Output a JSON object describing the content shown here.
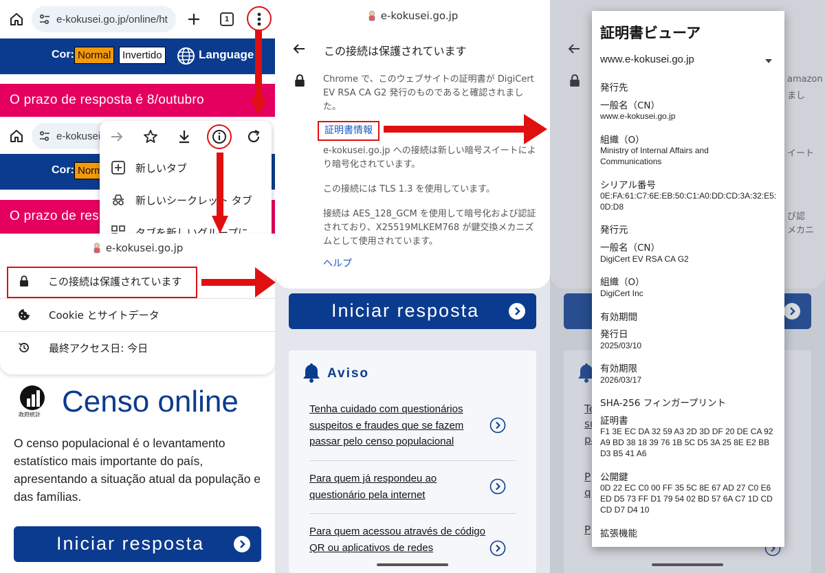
{
  "browser": {
    "url_full": "e-kokusei.go.jp/online/ht",
    "url_short": "e-kokusei",
    "tab_count": "1"
  },
  "site_header": {
    "cor_label": "Cor:",
    "normal_label": "Normal",
    "normal_short": "Norm",
    "invertido_label": "Invertido",
    "language_label": "Language"
  },
  "banner": {
    "deadline": "O prazo de resposta é 8/outubro",
    "deadline_partial": "O prazo de res"
  },
  "overflow_menu": {
    "new_tab": "新しいタブ",
    "incognito_tab": "新しいシークレット タブ",
    "group_tab": "タブを新しいグループに"
  },
  "site_info": {
    "host": "e-kokusei.go.jp",
    "connection_secure": "この接続は保護されています",
    "cookie_label": "Cookie とサイトデータ",
    "last_access": "最終アクセス日: 今日"
  },
  "page": {
    "logo_caption": "政府統計",
    "title": "Censo online",
    "description": "O censo populacional é o levantamento estatístico mais importante do país, apresentando a situação atual da população e das famílias.",
    "start_button": "Iniciar resposta"
  },
  "connection_detail": {
    "host": "e-kokusei.go.jp",
    "heading": "この接続は保護されています",
    "verified_text": "Chrome で、このウェブサイトの証明書が DigiCert EV RSA CA G2 発行のものであると確認されました。",
    "cert_info_link": "証明書情報",
    "cipher_suite_text": "e-kokusei.go.jp への接続は新しい暗号スイートにより暗号化されています。",
    "tls_text": "この接続には TLS 1.3 を使用しています。",
    "aes_text": "接続は AES_128_GCM を使用して暗号化および認証されており、X25519MLKEM768 が鍵交換メカニズムとして使用されています。",
    "help_link": "ヘルプ",
    "behind_fragment_1": "amazon",
    "behind_fragment_2": "まし",
    "behind_fragment_3": "イート",
    "behind_fragment_4": "び認",
    "behind_fragment_5": "メカニ"
  },
  "aviso": {
    "title": "Aviso",
    "links": [
      "Tenha cuidado com questionários suspeitos e fraudes que se fazem passar pelo censo populacional",
      "Para quem já respondeu ao questionário pela internet",
      "Para quem acessou através de código QR ou aplicativos de redes"
    ],
    "partial_letters": [
      "Te",
      "su",
      "pa",
      "P",
      "q",
      "P"
    ]
  },
  "certificate_viewer": {
    "title": "証明書ビューア",
    "selected": "www.e-kokusei.go.jp",
    "issued_to_heading": "発行先",
    "cn_label": "一般名（CN）",
    "cn_value": "www.e-kokusei.go.jp",
    "org_label": "組織（O）",
    "org_value": "Ministry of Internal Affairs and Communications",
    "serial_label": "シリアル番号",
    "serial_value": "0E:FA:61:C7:6E:EB:50:C1:A0:DD:CD:3A:32:E5:0D:D8",
    "issued_by_heading": "発行元",
    "issuer_cn_label": "一般名（CN）",
    "issuer_cn_value": "DigiCert EV RSA CA G2",
    "issuer_org_label": "組織（O）",
    "issuer_org_value": "DigiCert Inc",
    "validity_heading": "有効期間",
    "issued_on_label": "発行日",
    "issued_on_value": "2025/03/10",
    "expires_label": "有効期限",
    "expires_value": "2026/03/17",
    "fingerprint_heading": "SHA-256 フィンガープリント",
    "cert_fp_label": "証明書",
    "cert_fp_value": "F1 3E EC DA 32 59 A3 2D 3D DF 20 DE CA 92 A9 BD 38 18 39 76 1B 5C D5 3A 25 8E E2 BB D3 B5 41 A6",
    "pubkey_label": "公開鍵",
    "pubkey_value": "0D 22 EC C0 00 FF 35 5C 8E 67 AD 27 C0 E6 ED D5 73 FF D1 79 54 02 BD 57 6A C7 1D CD CD D7 D4 10",
    "extensions_label": "拡張機能"
  },
  "colors": {
    "brand_blue": "#0b3b8f",
    "banner_pink": "#e5005f",
    "normal_orange": "#f29a0a",
    "annotation_red": "#e01010",
    "link_blue": "#1a56c4"
  }
}
